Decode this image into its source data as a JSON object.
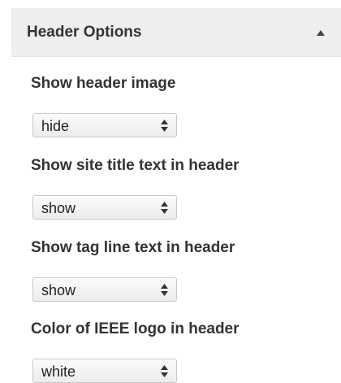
{
  "panel": {
    "title": "Header Options",
    "toggle_icon": "triangle-up-icon"
  },
  "options": [
    {
      "label": "Show header image",
      "value": "hide"
    },
    {
      "label": "Show site title text in header",
      "value": "show"
    },
    {
      "label": "Show tag line text in header",
      "value": "show"
    },
    {
      "label": "Color of IEEE logo in header",
      "value": "white"
    }
  ],
  "colors": {
    "header_background": "#eeeeee",
    "text": "#333333",
    "select_border": "#c8c8c8"
  }
}
